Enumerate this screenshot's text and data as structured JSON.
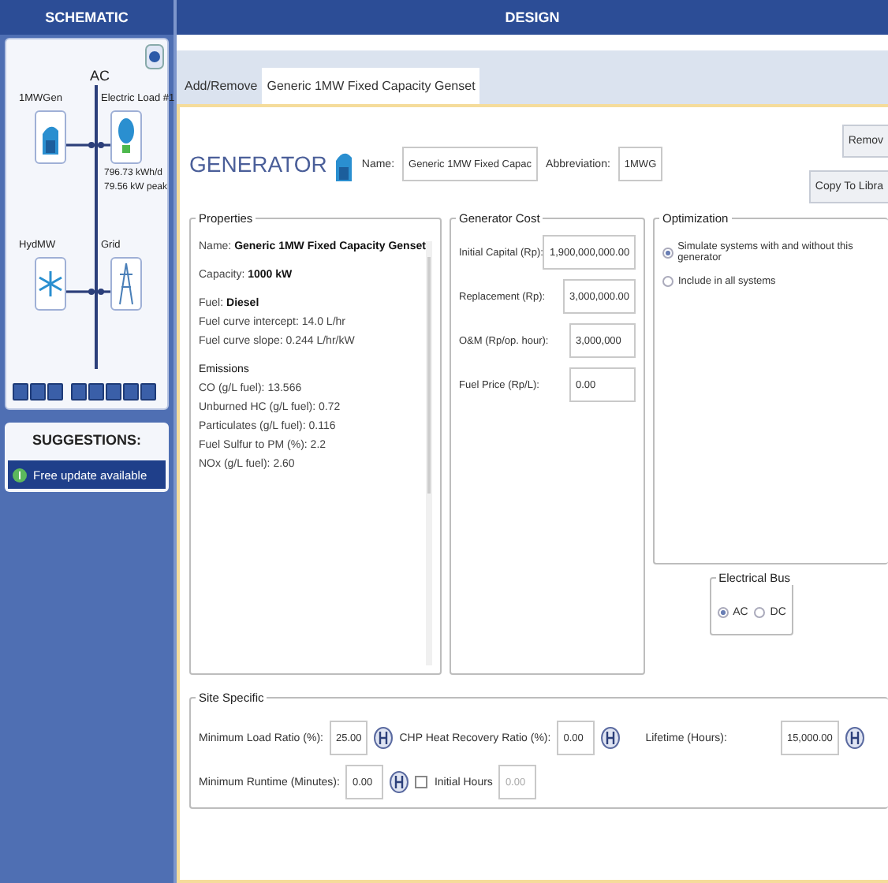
{
  "schematic": {
    "title": "SCHEMATIC",
    "bus_label": "AC",
    "components": [
      {
        "kind": "generator",
        "name": "1MWGen"
      },
      {
        "kind": "load",
        "name": "Electric Load #1",
        "details": [
          "796.73 kWh/d",
          "79.56 kW peak"
        ]
      },
      {
        "kind": "hydro",
        "name": "HydMW"
      },
      {
        "kind": "grid",
        "name": "Grid"
      }
    ]
  },
  "suggestions": {
    "title": "SUGGESTIONS:",
    "items": [
      {
        "text": "Free update available"
      }
    ]
  },
  "design": {
    "title": "DESIGN",
    "tabs": [
      {
        "label": "Add/Remove",
        "selected": false
      },
      {
        "label": "Generic 1MW Fixed Capacity Genset",
        "selected": true
      }
    ]
  },
  "generator": {
    "heading": "GENERATOR",
    "name_label": "Name:",
    "name_value": "Generic 1MW Fixed Capac",
    "abbr_label": "Abbreviation:",
    "abbr_value": "1MWG",
    "buttons": [
      "Remov",
      "Copy To Libra"
    ]
  },
  "properties": {
    "title": "Properties",
    "sections": [
      {
        "lines": [
          {
            "kind": "text",
            "text": "Name: **Generic 1MW Fixed Capacity Genset**"
          }
        ]
      },
      {
        "lines": [
          {
            "kind": "text",
            "text": "Capacity: **1000 kW**"
          }
        ]
      },
      {
        "lines": [
          {
            "kind": "text",
            "text": "Fuel: **Diesel**"
          },
          {
            "kind": "text",
            "text": "Fuel curve intercept: 14.0 L/hr"
          },
          {
            "kind": "text",
            "text": "Fuel curve slope: 0.244 L/hr/kW"
          }
        ]
      },
      {
        "lines": [
          {
            "kind": "heading",
            "text": "Emissions"
          },
          {
            "kind": "text",
            "text": "CO (g/L fuel): 13.566"
          },
          {
            "kind": "text",
            "text": "Unburned HC (g/L fuel): 0.72"
          },
          {
            "kind": "text",
            "text": "Particulates (g/L fuel): 0.116"
          },
          {
            "kind": "text",
            "text": "Fuel Sulfur to PM (%): 2.2"
          },
          {
            "kind": "text",
            "text": "NOx (g/L fuel): 2.60"
          }
        ]
      }
    ]
  },
  "generator_cost": {
    "title": "Generator Cost",
    "fields": [
      {
        "label": "Initial Capital (Rp):",
        "value": "1,900,000,000.00"
      },
      {
        "label": "Replacement (Rp):",
        "value": "3,000,000.00"
      },
      {
        "label": "O&M (Rp/op. hour):",
        "value": "3,000,000"
      },
      {
        "label": "Fuel Price (Rp/L):",
        "value": "0.00"
      }
    ]
  },
  "optimization": {
    "title": "Optimization",
    "options": [
      {
        "label": "Simulate systems with and without this generator",
        "selected": true
      },
      {
        "label": "Include in all systems",
        "selected": false
      }
    ]
  },
  "electrical_bus": {
    "title": "Electrical Bus",
    "options": [
      {
        "label": "AC",
        "selected": true
      },
      {
        "label": "DC",
        "selected": false
      }
    ]
  },
  "site_specific": {
    "title": "Site Specific",
    "rows": [
      [
        {
          "kind": "field",
          "label": "Minimum Load Ratio (%):",
          "value": "25.00"
        },
        {
          "kind": "field",
          "label": "CHP Heat Recovery Ratio (%):",
          "value": "0.00"
        },
        {
          "kind": "field",
          "label": "Lifetime (Hours):",
          "value": "15,000.00"
        }
      ],
      [
        {
          "kind": "field",
          "label": "Minimum Runtime (Minutes):",
          "value": "0.00"
        },
        {
          "kind": "checkbox",
          "label": "Initial Hours",
          "checked": false,
          "disabled": true,
          "value": "0.00"
        }
      ]
    ]
  }
}
